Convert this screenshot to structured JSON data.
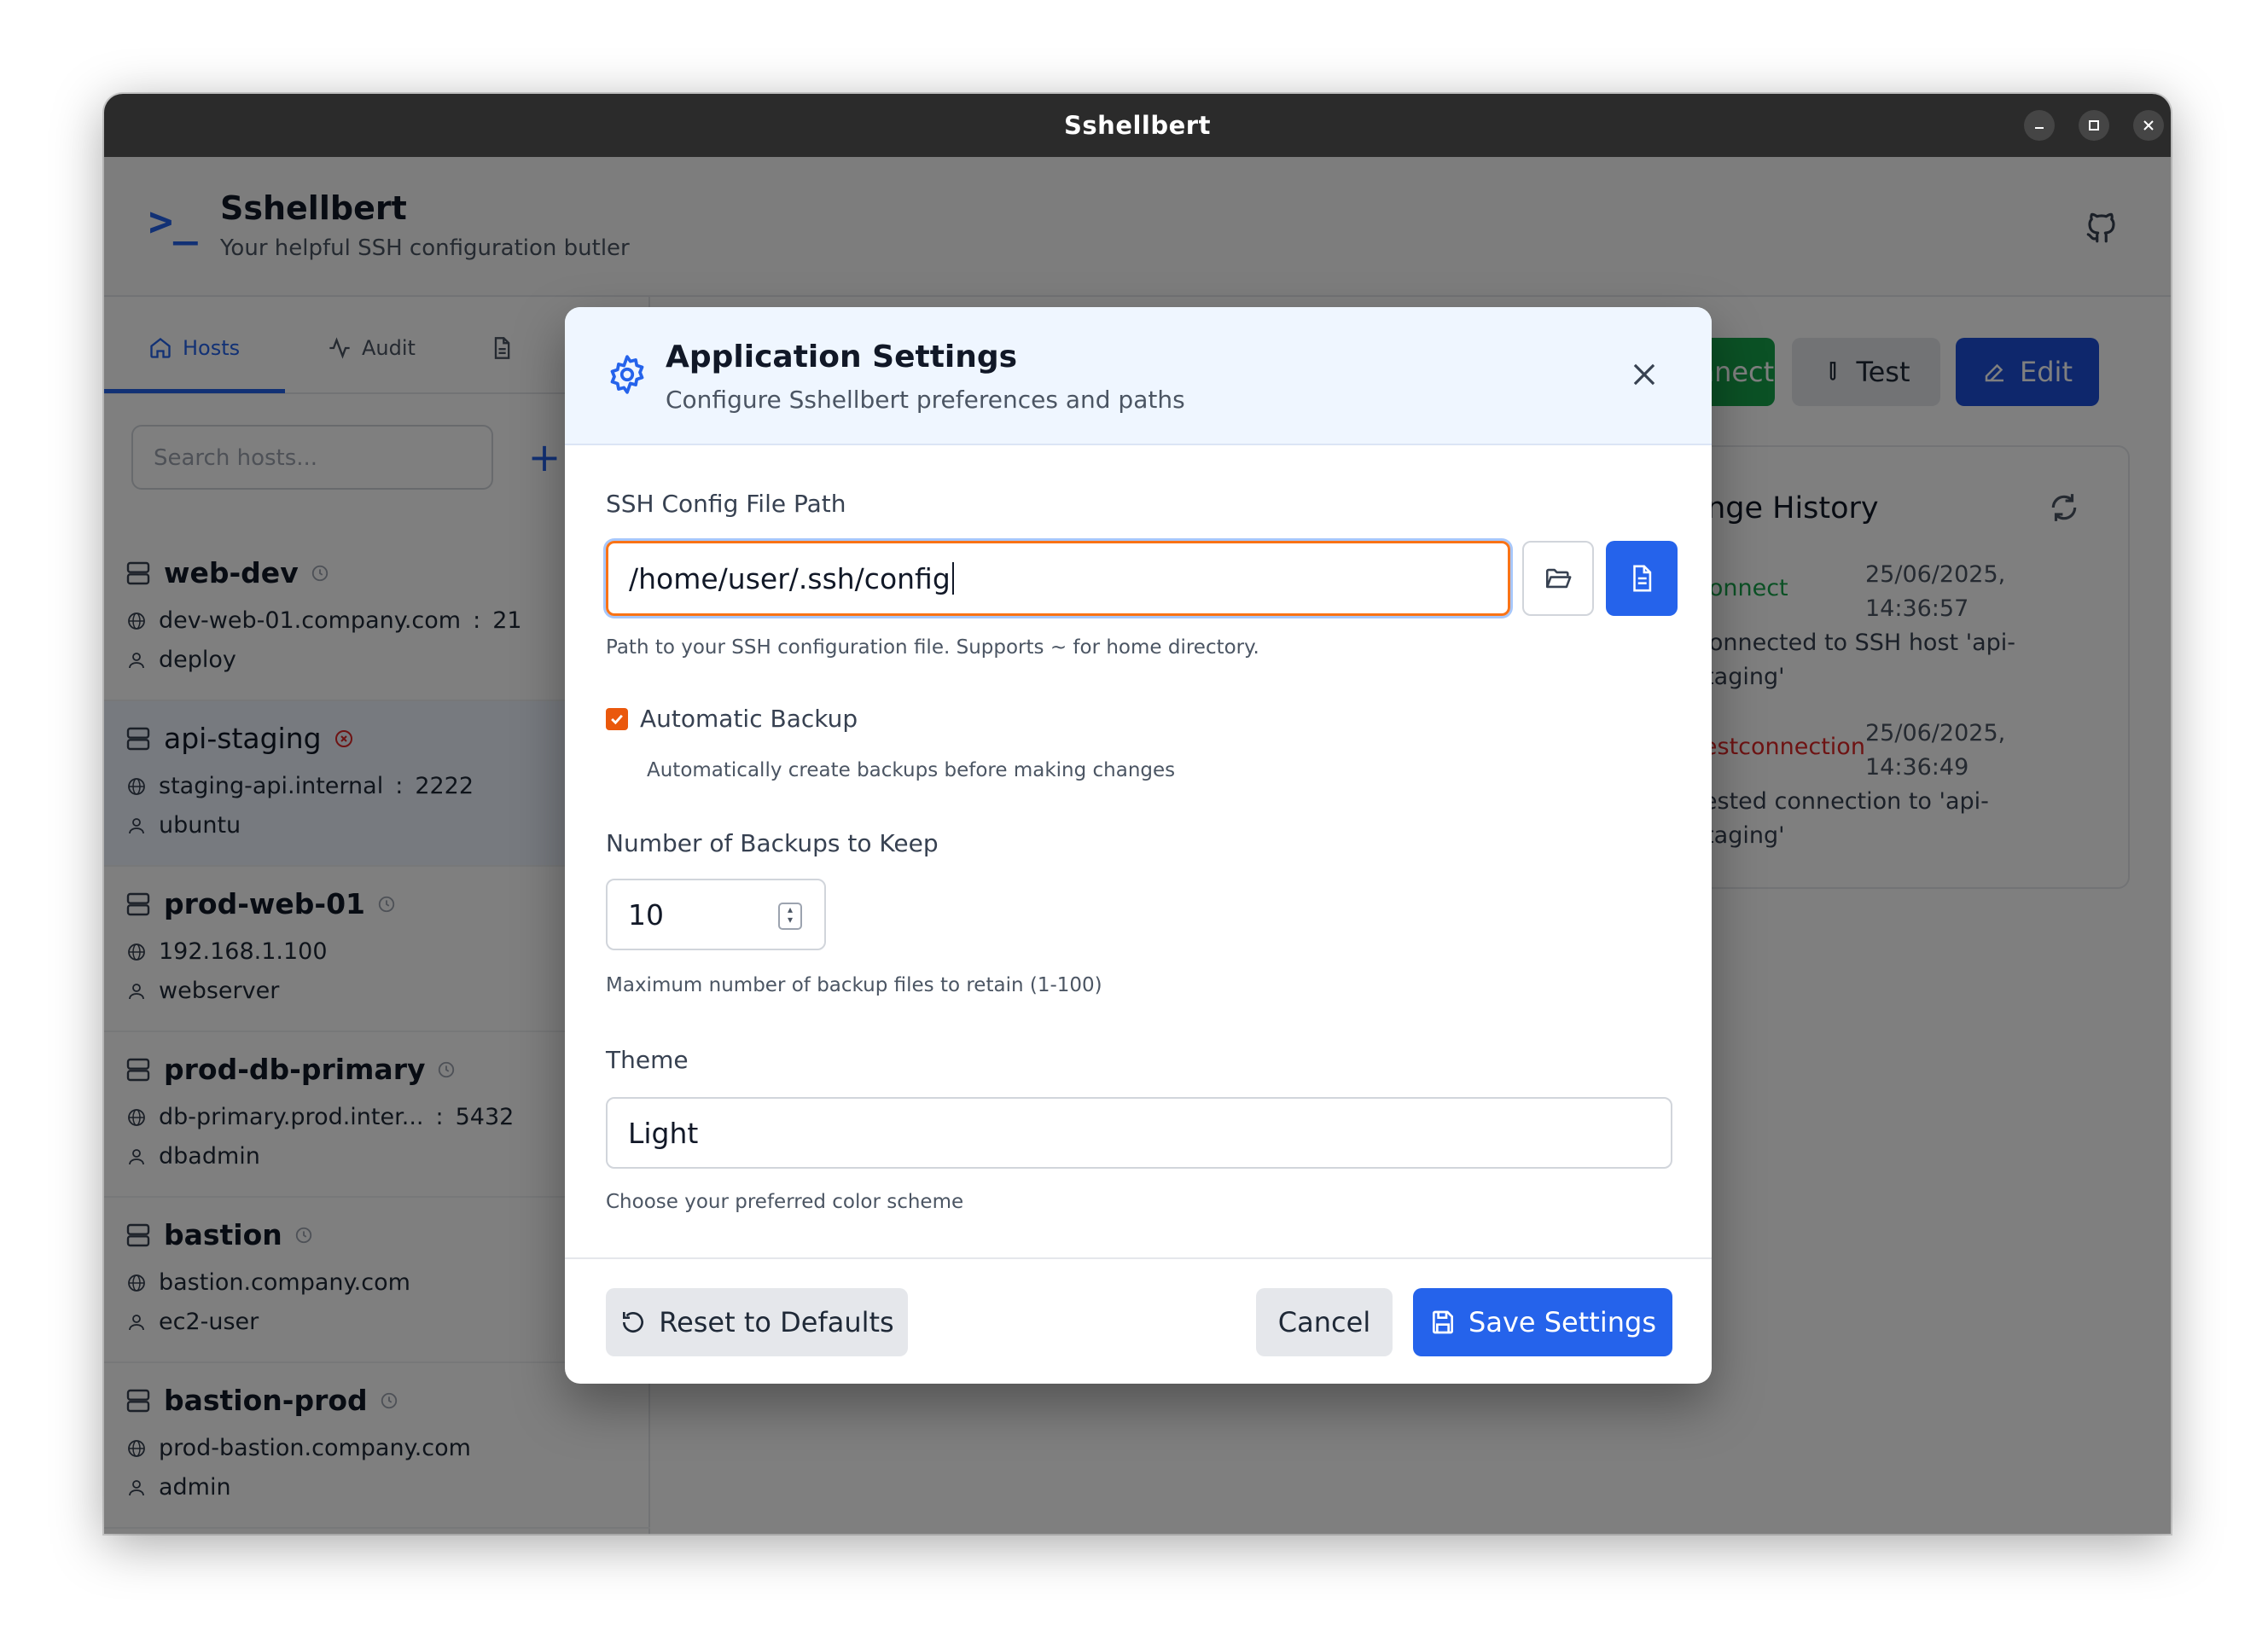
{
  "window": {
    "title": "Sshellbert"
  },
  "app": {
    "name": "Sshellbert",
    "tagline": "Your helpful SSH configuration butler",
    "prompt_symbol": ">_"
  },
  "sidebar": {
    "tabs": [
      {
        "label": "Hosts",
        "icon": "home-icon",
        "active": true
      },
      {
        "label": "Audit",
        "icon": "activity-icon",
        "active": false
      },
      {
        "label": "",
        "icon": "file-icon",
        "active": false
      }
    ],
    "search_placeholder": "Search hosts...",
    "add_label": "+",
    "hosts": [
      {
        "name": "web-dev",
        "host": "dev-web-01.company.com",
        "port": "21",
        "user": "deploy",
        "status": "clock"
      },
      {
        "name": "api-staging",
        "host": "staging-api.internal",
        "port": "2222",
        "user": "ubuntu",
        "status": "error",
        "selected": true
      },
      {
        "name": "prod-web-01",
        "host": "192.168.1.100",
        "port": "",
        "user": "webserver",
        "status": "clock"
      },
      {
        "name": "prod-db-primary",
        "host": "db-primary.prod.inter...",
        "port": "5432",
        "user": "dbadmin",
        "status": "clock"
      },
      {
        "name": "bastion",
        "host": "bastion.company.com",
        "port": "",
        "user": "ec2-user",
        "status": "clock"
      },
      {
        "name": "bastion-prod",
        "host": "prod-bastion.company.com",
        "port": "",
        "user": "admin",
        "status": "clock"
      }
    ]
  },
  "main": {
    "connect_label": "nnect",
    "test_label": "Test",
    "edit_label": "Edit",
    "history": {
      "title": "Change History",
      "entries": [
        {
          "action": "Connect",
          "time_line1": "25/06/2025,",
          "time_line2": "14:36:57",
          "desc_line1": "Connected to SSH host 'api-",
          "desc_line2": "staging'",
          "color": "#16a34a"
        },
        {
          "action": "Testconnection",
          "time_line1": "25/06/2025,",
          "time_line2": "14:36:49",
          "desc_line1": "Tested connection to 'api-",
          "desc_line2": "staging'",
          "color": "#dc2626"
        }
      ]
    }
  },
  "modal": {
    "title": "Application Settings",
    "subtitle": "Configure Sshellbert preferences and paths",
    "ssh_path": {
      "label": "SSH Config File Path",
      "value": "/home/user/.ssh/config",
      "help": "Path to your SSH configuration file. Supports ~ for home directory."
    },
    "backup": {
      "label": "Automatic Backup",
      "checked": true,
      "help": "Automatically create backups before making changes"
    },
    "backups_keep": {
      "label": "Number of Backups to Keep",
      "value": "10",
      "help": "Maximum number of backup files to retain (1-100)"
    },
    "theme": {
      "label": "Theme",
      "value": "Light",
      "help": "Choose your preferred color scheme"
    },
    "footer": {
      "reset_label": "Reset to Defaults",
      "cancel_label": "Cancel",
      "save_label": "Save Settings"
    }
  },
  "colors": {
    "accent": "#2563eb",
    "success": "#16a34a",
    "danger": "#dc2626",
    "checkbox": "#ea580c"
  }
}
